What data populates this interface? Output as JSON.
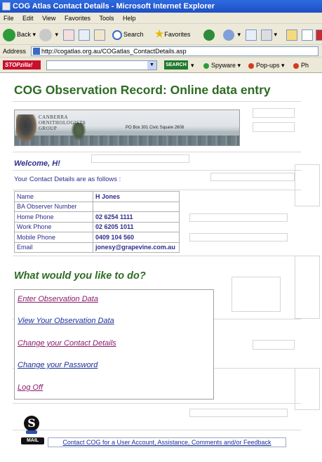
{
  "window": {
    "title": "COG Atlas Contact Details - Microsoft Internet Explorer"
  },
  "menubar": {
    "items": [
      "File",
      "Edit",
      "View",
      "Favorites",
      "Tools",
      "Help"
    ]
  },
  "toolbar": {
    "back": "Back",
    "search": "Search",
    "favorites": "Favorites"
  },
  "address": {
    "label": "Address",
    "url": "http://cogatlas.org.au/COGatlas_ContactDetails.asp"
  },
  "linkbar": {
    "logo": "STOPzilla!",
    "search_btn": "SEARCH",
    "spyware": "Spyware",
    "popups": "Pop-ups",
    "ph": "Ph"
  },
  "page": {
    "title": "COG Observation Record: Online data entry",
    "banner": {
      "org_line1": "CANBERRA",
      "org_line2": "ORNITHOLOGISTS",
      "org_line3": "GROUP",
      "po_box": "PO Box 301 Civic Square 2608"
    },
    "welcome": "Welcome, H!",
    "contact_intro": "Your Contact Details are as follows :",
    "contact_rows": [
      {
        "label": "Name",
        "value": "H Jones"
      },
      {
        "label": "BA Observer Number",
        "value": ""
      },
      {
        "label": "Home Phone",
        "value": "02 6254 1111"
      },
      {
        "label": "Work Phone",
        "value": "02 6205 1011"
      },
      {
        "label": "Mobile Phone",
        "value": "0409 104 560"
      },
      {
        "label": "Email",
        "value": "jonesy@grapevine.com.au"
      }
    ],
    "question": "What would you like to do?",
    "menu": [
      {
        "label": "Enter Observation Data",
        "color": "#8b1a6b"
      },
      {
        "label": "View Your Observation Data",
        "color": "#1a2f9b"
      },
      {
        "label": "Change your Contact Details",
        "color": "#8b1a6b"
      },
      {
        "label": "Change your Password",
        "color": "#1a2f9b"
      },
      {
        "label": "Log Off",
        "color": "#8b1a6b"
      }
    ],
    "mail_badge": "MAIL",
    "footer_link": "Contact COG for a User Account, Assistance, Comments and/or Feedback"
  },
  "colors": {
    "title_green": "#2d6b23",
    "text_navy": "#2d2d8c",
    "ie_blue": "#1d4fc2"
  }
}
